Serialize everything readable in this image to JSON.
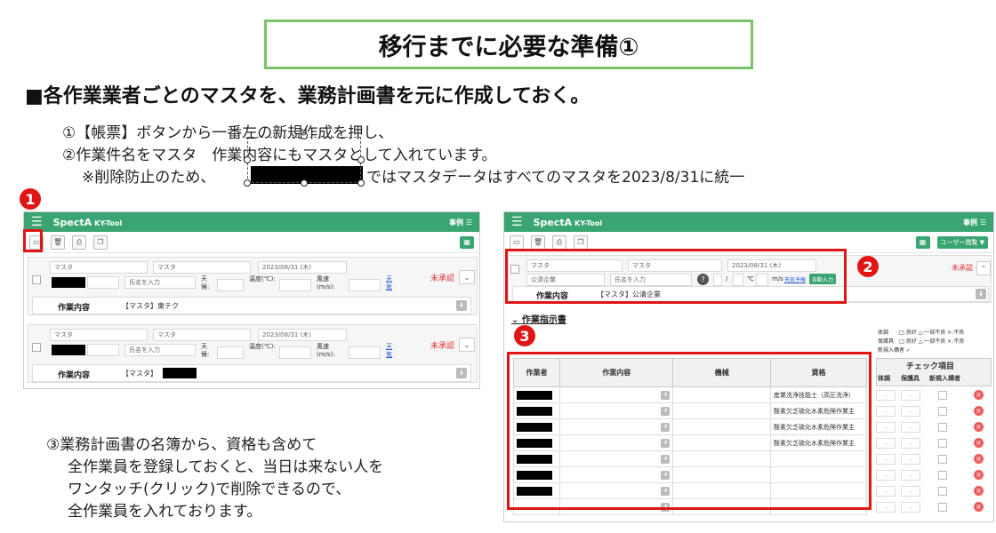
{
  "slide": {
    "title": "移行までに必要な準備①",
    "heading": "■各作業業者ごとのマスタを、業務計画書を元に作成しておく。",
    "notes": [
      "①【帳票】ボタンから一番左の新規作成を押し、",
      "②作業件名をマスタ　作業内容にもマスタとして入れています。",
      "※削除防止のため、",
      "ではマスタデータはすべてのマスタを2023/8/31に統一"
    ],
    "paragraph": [
      "③業務計画書の名簿から、資格も含めて",
      "全作業員を登録しておくと、当日は来ない人を",
      "ワンタッチ(クリック)で削除できるので、",
      "全作業員を入れております。"
    ],
    "badges": [
      "1",
      "2",
      "3"
    ]
  },
  "app_left": {
    "brand": "SpectA",
    "brand_sub": "KY-Tool",
    "header_right": "事例 ☰",
    "cards": [
      {
        "field1": "マスタ",
        "field2": "マスタ",
        "date": "2023/08/31 (木)",
        "name_placeholder": "氏名を入力",
        "weather_label": "天候:",
        "temp_label": "温度(℃):",
        "wind_label": "風速(m/s):",
        "link": "天気",
        "status": "未承認",
        "work_label": "作業内容",
        "work_value": "【マスタ】東テク"
      },
      {
        "field1": "マスタ",
        "field2": "マスタ",
        "date": "2023/08/31 (木)",
        "name_placeholder": "氏名を入力",
        "weather_label": "天候:",
        "temp_label": "温度(℃):",
        "wind_label": "風速(m/s):",
        "link": "天気",
        "status": "未承認",
        "work_label": "作業内容",
        "work_value": "【マスタ】"
      }
    ]
  },
  "app_right": {
    "brand": "SpectA",
    "brand_sub": "KY-Tool",
    "header_right": "事例 ☰",
    "user_button": "ユーザー閲覧 ▼",
    "card": {
      "field1": "マスタ",
      "field2": "マスタ",
      "date": "2023/08/31 (木)",
      "company": "公清企業",
      "name_placeholder": "氏名を入力",
      "slash": "/",
      "temp_unit": "℃",
      "wind_unit": "m/s",
      "weather_link": "天気予報",
      "auto_button": "自動入力",
      "status": "未承認",
      "work_label": "作業内容",
      "work_value": "【マスタ】公清企業"
    },
    "section": "作業指示書",
    "legend": [
      "体調　　□:良好 △:一部不良 ×:不良",
      "保護具　□:良好 △:一部不良 ×:不良",
      "新規入構者 ✓"
    ],
    "check_header": "チェック項目",
    "columns": [
      "作業者",
      "作業内容",
      "機械",
      "資格"
    ],
    "check_columns": [
      "体調",
      "保護具",
      "新規入構者"
    ],
    "qualifications": [
      "産業洗浄技能士（高圧洗浄）",
      "酸素欠乏硫化水素危険作業主",
      "酸素欠乏硫化水素危険作業主",
      "酸素欠乏硫化水素危険作業主",
      "",
      "",
      "",
      ""
    ],
    "select_placeholder": "- ",
    "delete_glyph": "×"
  }
}
